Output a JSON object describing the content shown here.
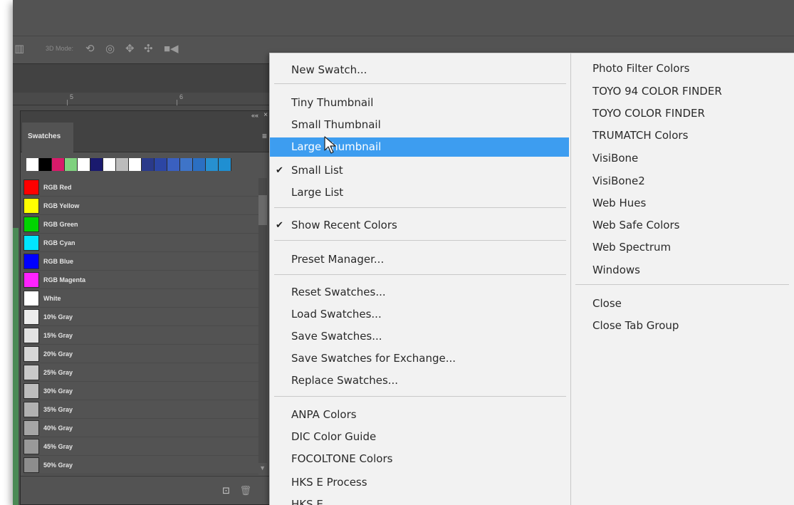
{
  "app": {
    "options_bar": {
      "mode_label": "3D Mode:",
      "icons": [
        "workspace-icon",
        "rotate-3d-icon",
        "roll-3d-icon",
        "drag-3d-icon",
        "slide-3d-icon",
        "zoom-3d-camera-icon"
      ]
    },
    "ruler": {
      "marks": [
        "5",
        "6"
      ]
    }
  },
  "panel": {
    "tab_label": "Swatches",
    "collapse_glyph": "««",
    "close_glyph": "×",
    "menu_glyph": "≡",
    "recent_colors": [
      "#ffffff",
      "#000000",
      "#d81b6a",
      "#7fd17f",
      "#ffffff",
      "#1a1a6e",
      "#ffffff",
      "#bcbcbc",
      "#ffffff",
      "#2a3a8a",
      "#2c46a4",
      "#3a60c0",
      "#3e74c8",
      "#2b6fc2",
      "#2790d0",
      "#1f8fd2"
    ],
    "swatches": [
      {
        "name": "RGB Red",
        "color": "#ff0000"
      },
      {
        "name": "RGB Yellow",
        "color": "#ffff00"
      },
      {
        "name": "RGB Green",
        "color": "#00d400"
      },
      {
        "name": "RGB Cyan",
        "color": "#00e5ff"
      },
      {
        "name": "RGB Blue",
        "color": "#0000ff"
      },
      {
        "name": "RGB Magenta",
        "color": "#ff22ff"
      },
      {
        "name": "White",
        "color": "#ffffff"
      },
      {
        "name": "10% Gray",
        "color": "#ececec"
      },
      {
        "name": "15% Gray",
        "color": "#e2e2e2"
      },
      {
        "name": "20% Gray",
        "color": "#d6d6d6"
      },
      {
        "name": "25% Gray",
        "color": "#c9c9c9"
      },
      {
        "name": "30% Gray",
        "color": "#bdbdbd"
      },
      {
        "name": "35% Gray",
        "color": "#b1b1b1"
      },
      {
        "name": "40% Gray",
        "color": "#a5a5a5"
      },
      {
        "name": "45% Gray",
        "color": "#999999"
      },
      {
        "name": "50% Gray",
        "color": "#8d8d8d"
      }
    ],
    "footer": {
      "new_glyph": "⊡",
      "delete_glyph": "🗑"
    }
  },
  "menu": {
    "col1": {
      "new_swatch": "New Swatch...",
      "tiny_thumbnail": "Tiny Thumbnail",
      "small_thumbnail": "Small Thumbnail",
      "large_thumbnail": "Large Thumbnail",
      "small_list": "Small List",
      "large_list": "Large List",
      "show_recent_colors": "Show Recent Colors",
      "preset_manager": "Preset Manager...",
      "reset_swatches": "Reset Swatches...",
      "load_swatches": "Load Swatches...",
      "save_swatches": "Save Swatches...",
      "save_swatches_exchange": "Save Swatches for Exchange...",
      "replace_swatches": "Replace Swatches...",
      "anpa_colors": "ANPA Colors",
      "dic_color_guide": "DIC Color Guide",
      "focoltone_colors": "FOCOLTONE Colors",
      "hks_e_process": "HKS E Process",
      "hks_e": "HKS E"
    },
    "col2": {
      "photo_filter_colors": "Photo Filter Colors",
      "toyo_94": "TOYO 94 COLOR FINDER",
      "toyo": "TOYO COLOR FINDER",
      "trumatch": "TRUMATCH Colors",
      "visibone": "VisiBone",
      "visibone2": "VisiBone2",
      "web_hues": "Web Hues",
      "web_safe": "Web Safe Colors",
      "web_spectrum": "Web Spectrum",
      "windows": "Windows",
      "close": "Close",
      "close_tab_group": "Close Tab Group"
    },
    "check_glyph": "✔",
    "highlight_color": "#3d9df0"
  }
}
